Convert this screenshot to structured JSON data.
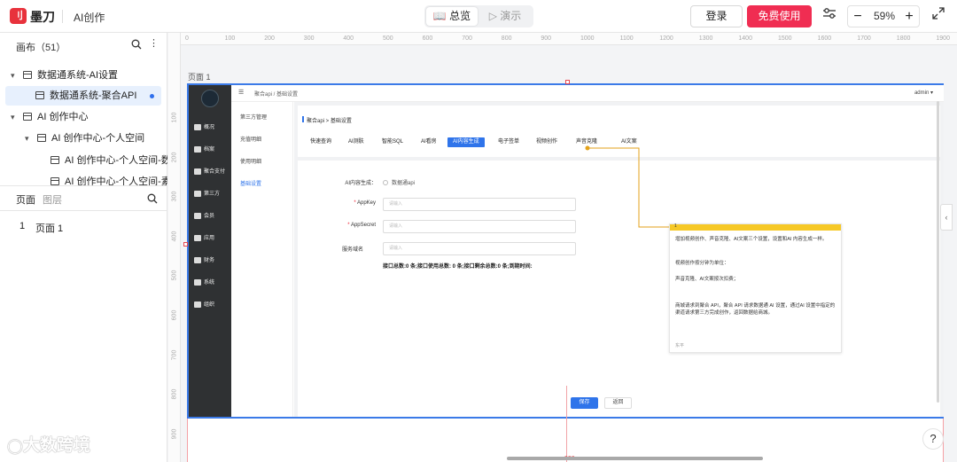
{
  "topbar": {
    "logo_glyph": "刂",
    "brand": "墨刀",
    "project_title": "AI创作",
    "mode_overview": "总览",
    "mode_present": "演示",
    "login": "登录",
    "free_use": "免费使用",
    "zoom_level": "59%",
    "zoom_out": "−",
    "zoom_in": "+"
  },
  "left_panel": {
    "canvas_header": "画布（51）",
    "tree": [
      {
        "label": "数据通系统-AI设置",
        "level": 0
      },
      {
        "label": "数据通系统-聚合API",
        "level": 1,
        "selected": true
      },
      {
        "label": "AI 创作中心",
        "level": 0
      },
      {
        "label": "AI 创作中心-个人空间",
        "level": 1
      },
      {
        "label": "AI 创作中心-个人空间-数...",
        "level": 2
      },
      {
        "label": "AI 创作中心-个人空间-素...",
        "level": 2
      }
    ],
    "tab_pages": "页面",
    "tab_layers": "图层",
    "pages": [
      {
        "num": "1",
        "label": "页面 1"
      }
    ]
  },
  "canvas": {
    "page_label": "页面 1",
    "ruler_h": [
      "0",
      "100",
      "200",
      "300",
      "400",
      "500",
      "600",
      "700",
      "800",
      "900",
      "1000",
      "1100",
      "1200",
      "1300",
      "1400",
      "1500",
      "1600",
      "1700",
      "1800",
      "1900"
    ],
    "ruler_v": [
      "100",
      "200",
      "300",
      "400",
      "500",
      "600",
      "700",
      "800",
      "900"
    ],
    "bottom_label": "900"
  },
  "mock": {
    "breadcrumb_top": "聚合api  /  基础设置",
    "admin": "admin ▾",
    "nav": [
      "概况",
      "档案",
      "聚合支付",
      "第三方",
      "会员",
      "应用",
      "财务",
      "系统",
      "组织"
    ],
    "sub_menu": [
      "第三方管理",
      "充值明细",
      "使用明细",
      "基础设置"
    ],
    "card_title": "聚合api > 基础设置",
    "tabs": [
      "快速查询",
      "AI测肤",
      "智能SQL",
      "AI看房",
      "AI内容生成",
      "电子签单",
      "视频创作",
      "声音克隆",
      "AI文案"
    ],
    "active_tab": "AI内容生成",
    "form": {
      "ai_gen_label": "AI内容生成：",
      "ai_gen_option": "数据通api",
      "appkey_label": "AppKey",
      "appkey_placeholder": "请输入",
      "appsecret_label": "AppSecret",
      "appsecret_placeholder": "请输入",
      "domain_label": "服务域名",
      "domain_placeholder": "请输入",
      "stats": "接口总数:0 条;接口使用总数: 0 条;接口剩余总数:0 条;到期时间:"
    },
    "save": "保存",
    "back": "返回"
  },
  "note": {
    "number": "1",
    "p1": "增加视频创作、声音克隆、AI文案三个设置，设置和AI 内容生成一样。",
    "p2": "视频创作按分钟为单位：",
    "p3": "声音克隆、AI文案按次扣费；",
    "p4": "商城请求到聚合 API，聚合 API 请求数据通 AI 设置，通过AI 设置中指定的渠道请求第三方完成创作，返回数据给商城。",
    "footer": "东平"
  },
  "help": "?",
  "side_toggle": "‹",
  "watermark": "大数跨境"
}
